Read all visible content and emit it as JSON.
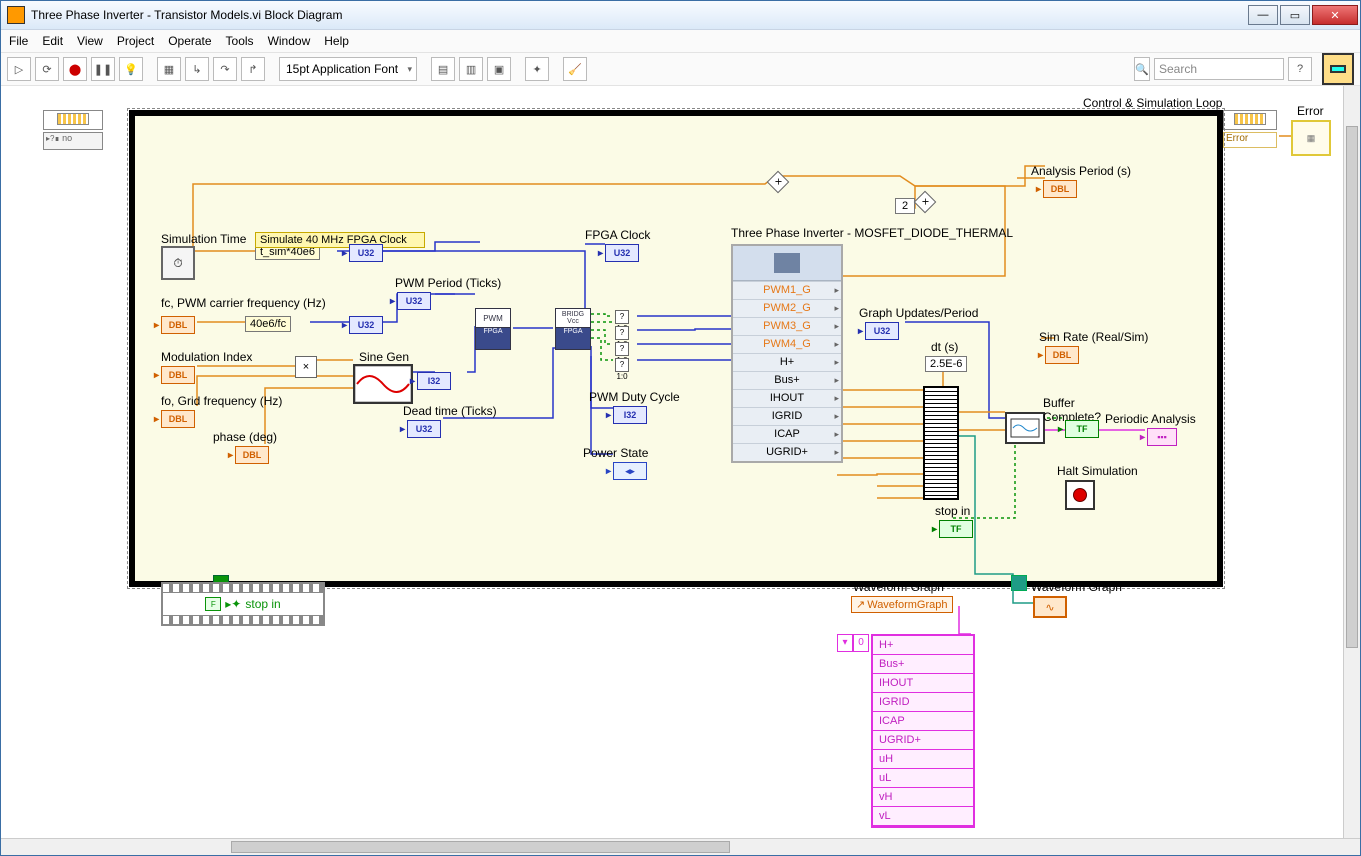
{
  "window": {
    "title": "Three Phase Inverter - Transistor Models.vi Block Diagram",
    "buttons": {
      "min": "—",
      "max": "▭",
      "close": "✕"
    }
  },
  "menu": [
    "File",
    "Edit",
    "View",
    "Project",
    "Operate",
    "Tools",
    "Window",
    "Help"
  ],
  "toolbar": {
    "font": "15pt Application Font",
    "search_placeholder": "Search"
  },
  "loop_label": "Control & Simulation Loop",
  "left_cfg_caption": "no",
  "error": {
    "label": "Error",
    "wire_label": "Error"
  },
  "labels": {
    "sim_time": "Simulation Time",
    "sim_time_expr": "t_sim*40e6",
    "fpga_clock_box": "Simulate 40 MHz FPGA Clock",
    "fc": "fc, PWM carrier frequency (Hz)",
    "fc_expr": "40e6/fc",
    "mod_index": "Modulation Index",
    "fo": "fo, Grid frequency (Hz)",
    "phase": "phase (deg)",
    "sine_gen": "Sine Gen",
    "pwm_period": "PWM Period (Ticks)",
    "dead_time": "Dead time (Ticks)",
    "fpga_clock": "FPGA Clock",
    "pwm_duty": "PWM Duty Cycle",
    "power_state": "Power State",
    "analysis_period": "Analysis Period (s)",
    "two": "2",
    "graph_updates": "Graph Updates/Period",
    "dt": "dt (s)",
    "dt_val": "2.5E-6",
    "sim_rate": "Sim Rate (Real/Sim)",
    "buffer_complete": "Buffer Complete?",
    "periodic_analysis": "Periodic Analysis",
    "halt_sim": "Halt Simulation",
    "stop_in": "stop in",
    "wave_graph": "Waveform Graph",
    "wave_graph_ref": "WaveformGraph",
    "film_stop": "stop in",
    "subvi_title": "Three Phase Inverter - MOSFET_DIODE_THERMAL",
    "time_icon": "⏱"
  },
  "subvi_rows": [
    {
      "t": "PWM1_G",
      "c": "orange"
    },
    {
      "t": "PWM2_G",
      "c": "orange"
    },
    {
      "t": "PWM3_G",
      "c": "orange"
    },
    {
      "t": "PWM4_G",
      "c": "orange"
    },
    {
      "t": "H+",
      "c": ""
    },
    {
      "t": "Bus+",
      "c": ""
    },
    {
      "t": "IHOUT",
      "c": ""
    },
    {
      "t": "IGRID",
      "c": ""
    },
    {
      "t": "ICAP",
      "c": ""
    },
    {
      "t": "UGRID+",
      "c": ""
    }
  ],
  "types": {
    "dbl": "DBL",
    "u32": "U32",
    "i32": "I32",
    "tf": "TF"
  },
  "array": {
    "index": "0",
    "items": [
      "H+",
      "Bus+",
      "IHOUT",
      "IGRID",
      "ICAP",
      "UGRID+",
      "uH",
      "uL",
      "vH",
      "vL"
    ]
  },
  "sel_labels": [
    "?1:0",
    "?1:0",
    "?1:0",
    "?1:0"
  ]
}
